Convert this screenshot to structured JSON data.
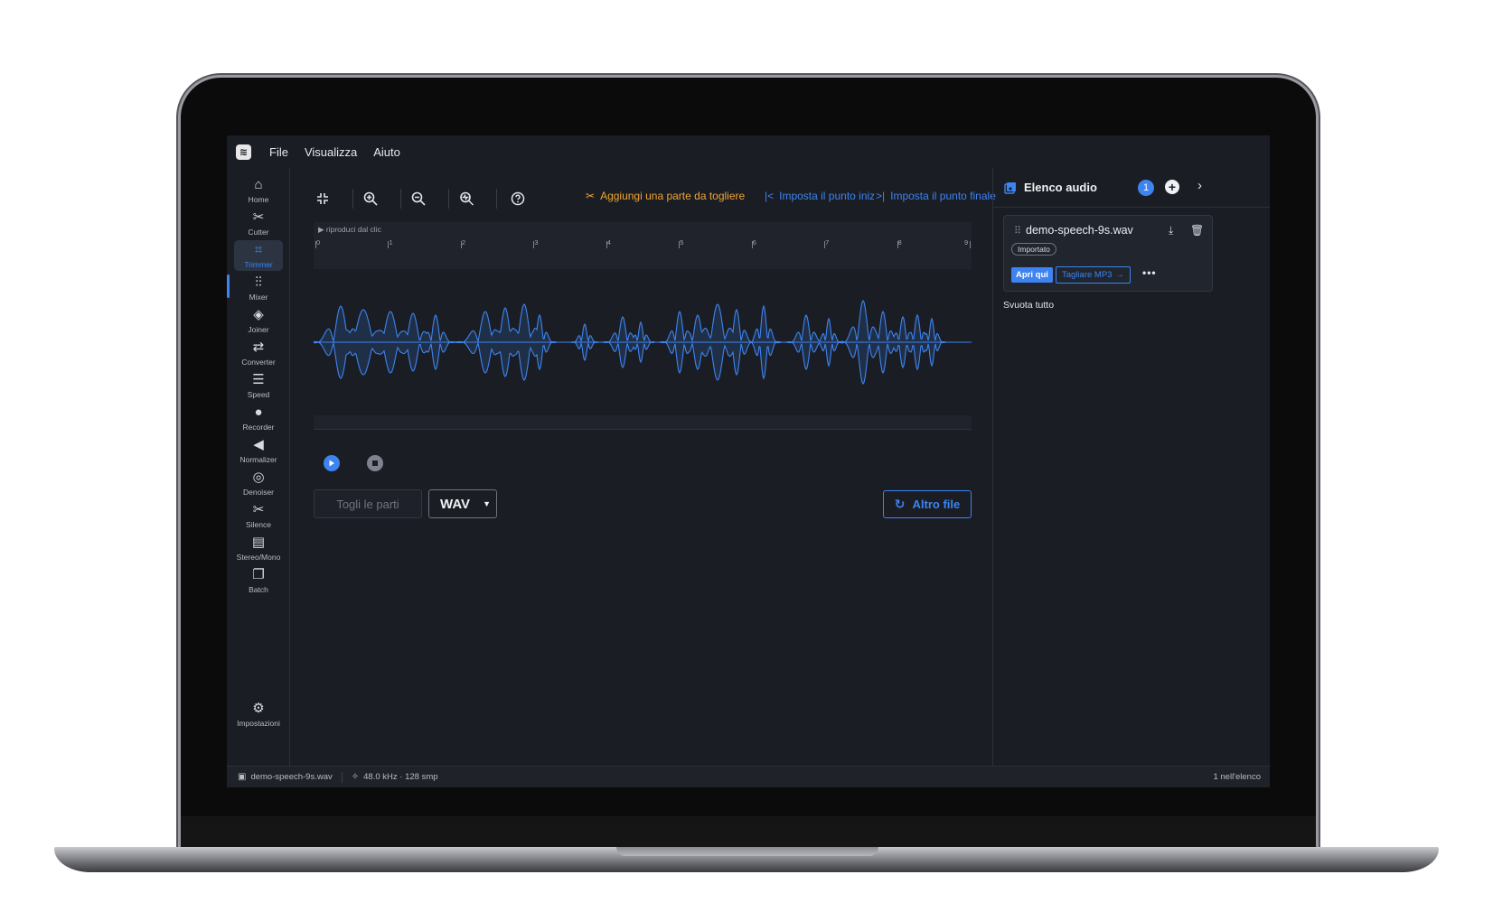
{
  "menubar": {
    "items": [
      "File",
      "Visualizza",
      "Aiuto"
    ]
  },
  "sidebar": {
    "items": [
      {
        "label": "Home",
        "icon": "home-icon"
      },
      {
        "label": "Cutter",
        "icon": "scissors-icon"
      },
      {
        "label": "Trimmer",
        "icon": "crop-icon",
        "active": true
      },
      {
        "label": "Mixer",
        "icon": "mixer-icon"
      },
      {
        "label": "Joiner",
        "icon": "layers-icon"
      },
      {
        "label": "Converter",
        "icon": "swap-icon"
      },
      {
        "label": "Speed",
        "icon": "sliders-icon"
      },
      {
        "label": "Recorder",
        "icon": "microphone-icon"
      },
      {
        "label": "Normalizer",
        "icon": "speaker-icon"
      },
      {
        "label": "Denoiser",
        "icon": "denoise-icon"
      },
      {
        "label": "Silence",
        "icon": "scissors-icon"
      },
      {
        "label": "Stereo/Mono",
        "icon": "stereo-icon"
      },
      {
        "label": "Batch",
        "icon": "batch-icon"
      }
    ],
    "settings_label": "Impostazioni"
  },
  "toolbar": {
    "add_cut_label": "Aggiungi una parte da togliere",
    "set_start_label": "Imposta il punto iniziale",
    "set_end_label": "Imposta il punto finale"
  },
  "timeline": {
    "caption": "▶ riproduci dal clic",
    "ticks": [
      "0",
      "1",
      "2",
      "3",
      "4",
      "5",
      "6",
      "7",
      "8",
      "9"
    ],
    "wave_color": "#3d84f0"
  },
  "actions": {
    "cut_label": "Togli le parti",
    "format_value": "WAV",
    "other_file_label": "Altro file"
  },
  "panel": {
    "title": "Elenco audio",
    "count": "1",
    "file": {
      "name": "demo-speech-9s.wav",
      "tag": "Importato",
      "open_label": "Apri qui",
      "cut_label": "Tagliare MP3"
    },
    "clear_label": "Svuota tutto"
  },
  "status": {
    "file": "demo-speech-9s.wav",
    "info": "48.0 kHz · 128 smp",
    "count": "1 nell'elenco"
  },
  "colors": {
    "accent": "#3d84f0",
    "warning": "#f0a531",
    "background": "#1a1d24"
  }
}
